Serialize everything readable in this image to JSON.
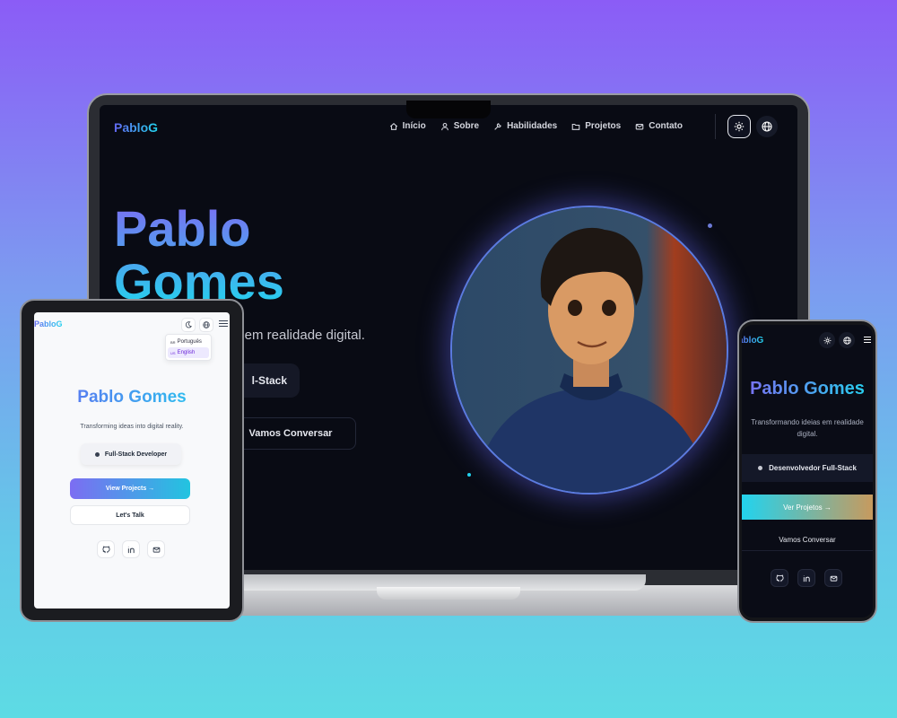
{
  "laptop": {
    "logo": "PabloG",
    "nav": [
      {
        "label": "Início",
        "icon": "home-icon"
      },
      {
        "label": "Sobre",
        "icon": "user-icon"
      },
      {
        "label": "Habilidades",
        "icon": "wrench-icon"
      },
      {
        "label": "Projetos",
        "icon": "folder-icon"
      },
      {
        "label": "Contato",
        "icon": "mail-icon"
      }
    ],
    "title_line1": "Pablo",
    "title_line2": "Gomes",
    "tagline": "s em realidade digital.",
    "role": "l-Stack",
    "cta": "Vamos Conversar"
  },
  "tablet": {
    "logo": "PabloG",
    "lang_menu": [
      {
        "label": "Português",
        "flag": "BR"
      },
      {
        "label": "English",
        "flag": "US"
      }
    ],
    "title": "Pablo Gomes",
    "tagline": "Transforming ideas into digital reality.",
    "role": "Full-Stack Developer",
    "cta_primary": "View Projects →",
    "cta_secondary": "Let's Talk"
  },
  "phone": {
    "logo": "abloG",
    "title": "Pablo Gomes",
    "tagline": "Transformando ideias em realidade digital.",
    "role": "Desenvolvedor Full-Stack",
    "cta_primary": "Ver Projetos →",
    "cta_secondary": "Vamos Conversar"
  },
  "colors": {
    "accent_start": "#6366f1",
    "accent_end": "#22d3ee",
    "bg_dark": "#090b14"
  }
}
